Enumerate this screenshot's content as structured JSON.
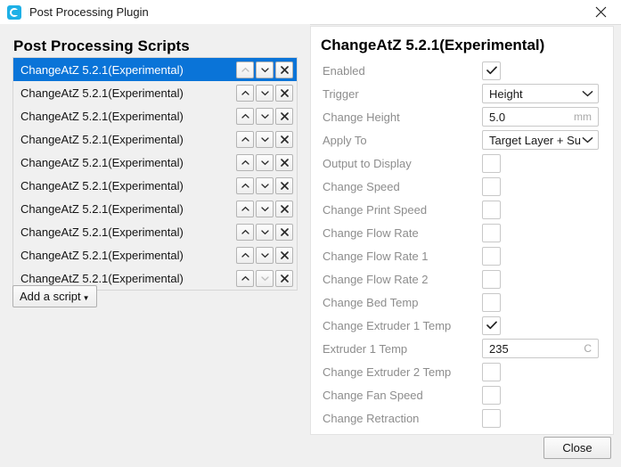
{
  "window": {
    "title": "Post Processing Plugin",
    "app_icon": "cura-logo-icon",
    "close_icon": "close-icon",
    "accent_color": "#1eb0e6",
    "selection_color": "#0a74d8"
  },
  "left_pane": {
    "heading": "Post Processing Scripts",
    "scripts": [
      {
        "label": "ChangeAtZ 5.2.1(Experimental)",
        "selected": true,
        "up_enabled": false,
        "down_enabled": true
      },
      {
        "label": "ChangeAtZ 5.2.1(Experimental)",
        "selected": false,
        "up_enabled": true,
        "down_enabled": true
      },
      {
        "label": "ChangeAtZ 5.2.1(Experimental)",
        "selected": false,
        "up_enabled": true,
        "down_enabled": true
      },
      {
        "label": "ChangeAtZ 5.2.1(Experimental)",
        "selected": false,
        "up_enabled": true,
        "down_enabled": true
      },
      {
        "label": "ChangeAtZ 5.2.1(Experimental)",
        "selected": false,
        "up_enabled": true,
        "down_enabled": true
      },
      {
        "label": "ChangeAtZ 5.2.1(Experimental)",
        "selected": false,
        "up_enabled": true,
        "down_enabled": true
      },
      {
        "label": "ChangeAtZ 5.2.1(Experimental)",
        "selected": false,
        "up_enabled": true,
        "down_enabled": true
      },
      {
        "label": "ChangeAtZ 5.2.1(Experimental)",
        "selected": false,
        "up_enabled": true,
        "down_enabled": true
      },
      {
        "label": "ChangeAtZ 5.2.1(Experimental)",
        "selected": false,
        "up_enabled": true,
        "down_enabled": true
      },
      {
        "label": "ChangeAtZ 5.2.1(Experimental)",
        "selected": false,
        "up_enabled": true,
        "down_enabled": false
      }
    ],
    "row_icons": {
      "move_up": "chevron-up-icon",
      "move_down": "chevron-down-icon",
      "remove": "close-x-icon"
    },
    "add_script": {
      "label": "Add a script",
      "caret_icon": "caret-down-icon"
    }
  },
  "right_pane": {
    "title": "ChangeAtZ 5.2.1(Experimental)",
    "settings": [
      {
        "label": "Enabled",
        "type": "checkbox",
        "checked": true
      },
      {
        "label": "Trigger",
        "type": "combobox",
        "value": "Height"
      },
      {
        "label": "Change Height",
        "type": "text",
        "value": "5.0",
        "unit": "mm"
      },
      {
        "label": "Apply To",
        "type": "combobox",
        "value": "Target Layer + Su…"
      },
      {
        "label": "Output to Display",
        "type": "checkbox",
        "checked": false
      },
      {
        "label": "Change Speed",
        "type": "checkbox",
        "checked": false
      },
      {
        "label": "Change Print Speed",
        "type": "checkbox",
        "checked": false
      },
      {
        "label": "Change Flow Rate",
        "type": "checkbox",
        "checked": false
      },
      {
        "label": "Change Flow Rate 1",
        "type": "checkbox",
        "checked": false
      },
      {
        "label": "Change Flow Rate 2",
        "type": "checkbox",
        "checked": false
      },
      {
        "label": "Change Bed Temp",
        "type": "checkbox",
        "checked": false
      },
      {
        "label": "Change Extruder 1 Temp",
        "type": "checkbox",
        "checked": true
      },
      {
        "label": "Extruder 1 Temp",
        "type": "text",
        "value": "235",
        "unit": "C"
      },
      {
        "label": "Change Extruder 2 Temp",
        "type": "checkbox",
        "checked": false
      },
      {
        "label": "Change Fan Speed",
        "type": "checkbox",
        "checked": false
      },
      {
        "label": "Change Retraction",
        "type": "checkbox",
        "checked": false
      }
    ]
  },
  "footer": {
    "close_label": "Close"
  }
}
